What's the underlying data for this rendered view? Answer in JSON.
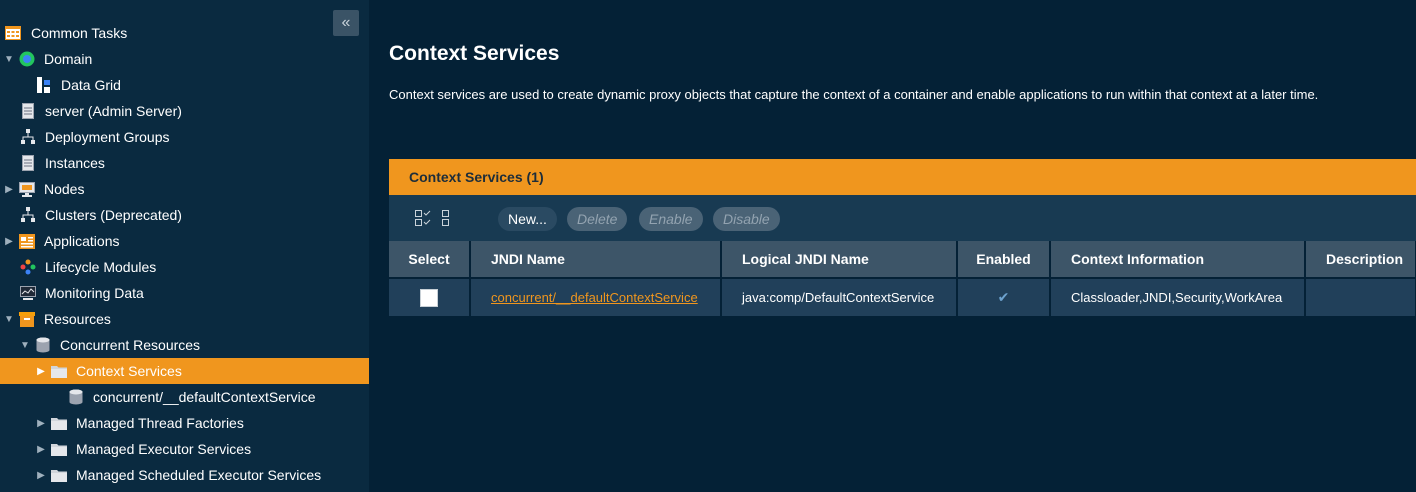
{
  "sidebar": {
    "collapse_glyph": "«",
    "items": [
      {
        "label": "Common Tasks",
        "icon": "calendar-icon"
      },
      {
        "label": "Domain",
        "icon": "globe-icon",
        "toggle": "▼"
      },
      {
        "label": "Data Grid",
        "icon": "data-grid-icon"
      },
      {
        "label": "server (Admin Server)",
        "icon": "server-icon"
      },
      {
        "label": "Deployment Groups",
        "icon": "hierarchy-icon"
      },
      {
        "label": "Instances",
        "icon": "server-icon"
      },
      {
        "label": "Nodes",
        "icon": "monitor-icon",
        "toggle": "▶"
      },
      {
        "label": "Clusters (Deprecated)",
        "icon": "hierarchy-icon"
      },
      {
        "label": "Applications",
        "icon": "applications-icon",
        "toggle": "▶"
      },
      {
        "label": "Lifecycle Modules",
        "icon": "lifecycle-icon"
      },
      {
        "label": "Monitoring Data",
        "icon": "monitoring-icon"
      },
      {
        "label": "Resources",
        "icon": "box-icon",
        "toggle": "▼"
      },
      {
        "label": "Concurrent Resources",
        "icon": "database-icon",
        "toggle": "▼"
      },
      {
        "label": "Context Services",
        "icon": "folder-icon",
        "toggle": "▶"
      },
      {
        "label": "concurrent/__defaultContextService",
        "icon": "database-icon"
      },
      {
        "label": "Managed Thread Factories",
        "icon": "folder-icon",
        "toggle": "▶"
      },
      {
        "label": "Managed Executor Services",
        "icon": "folder-icon",
        "toggle": "▶"
      },
      {
        "label": "Managed Scheduled Executor Services",
        "icon": "folder-icon",
        "toggle": "▶"
      }
    ]
  },
  "main": {
    "title": "Context Services",
    "description": "Context services are used to create dynamic proxy objects that capture the context of a container and enable applications to run within that context at a later time.",
    "table_title": "Context Services (1)",
    "toolbar": {
      "new_label": "New...",
      "delete_label": "Delete",
      "enable_label": "Enable",
      "disable_label": "Disable"
    },
    "columns": [
      "Select",
      "JNDI Name",
      "Logical JNDI Name",
      "Enabled",
      "Context Information",
      "Description"
    ],
    "rows": [
      {
        "jndi_name": "concurrent/__defaultContextService",
        "logical_jndi_name": "java:comp/DefaultContextService",
        "enabled": "✔",
        "context_information": "Classloader,JNDI,Security,WorkArea",
        "description": ""
      }
    ]
  },
  "colors": {
    "accent": "#f0961e",
    "background": "#042136",
    "sidebar": "#0a2a40"
  }
}
